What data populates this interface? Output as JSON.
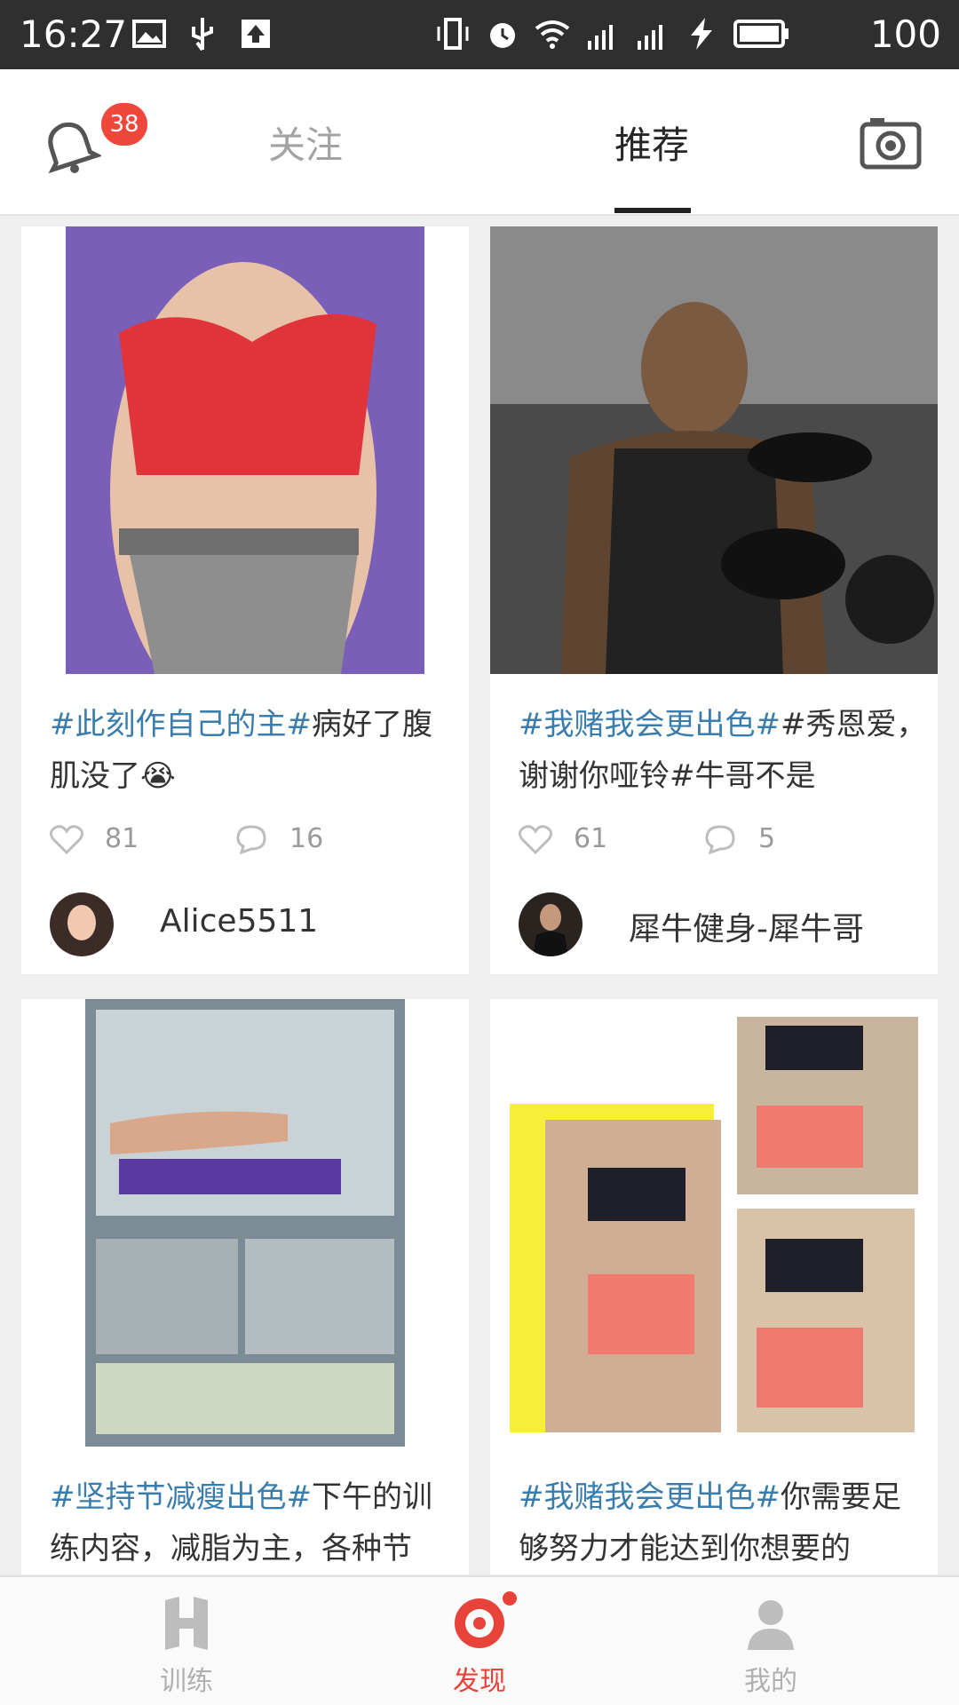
{
  "status_bar": {
    "time": "16:27",
    "battery": "100"
  },
  "header": {
    "notification_count": "38",
    "tabs": [
      {
        "label": "关注",
        "active": false
      },
      {
        "label": "推荐",
        "active": true
      }
    ]
  },
  "feed": [
    {
      "tag": "#此刻作自己的主#",
      "text": "病好了腹肌没了😭",
      "likes": "81",
      "comments": "16",
      "user": "Alice5511"
    },
    {
      "tag": "#我赌我会更出色#",
      "text": "#秀恩爱，谢谢你哑铃#牛哥不是",
      "likes": "61",
      "comments": "5",
      "user": "犀牛健身-犀牛哥"
    },
    {
      "tag": "#坚持节减瘦出色#",
      "text": "下午的训练内容，减脂为主，各种节"
    },
    {
      "tag": "#我赌我会更出色#",
      "text": "你需要足够努力才能达到你想要的"
    }
  ],
  "bottom_nav": [
    {
      "label": "训练",
      "icon": "train-icon"
    },
    {
      "label": "发现",
      "icon": "discover-icon",
      "active": true
    },
    {
      "label": "我的",
      "icon": "profile-icon"
    }
  ],
  "colors": {
    "accent": "#e8433a",
    "tag": "#3a7dad",
    "badge": "#f0473c"
  }
}
